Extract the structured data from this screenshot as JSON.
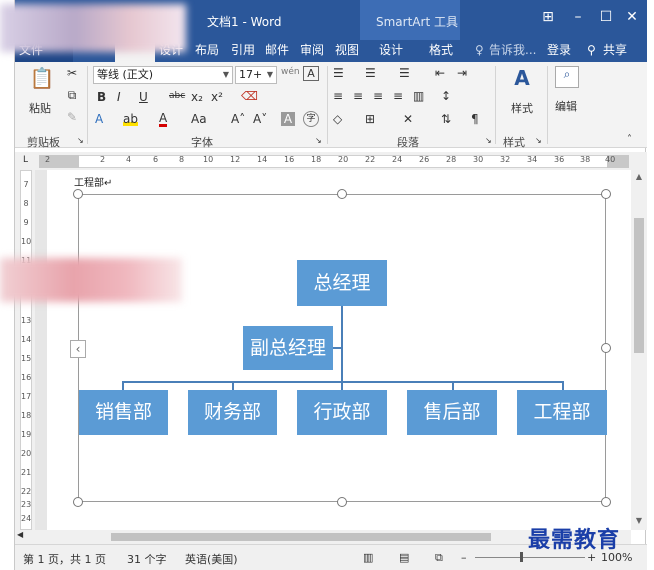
{
  "window": {
    "title": "文档1 - Word",
    "context_tab_group": "SmartArt 工具",
    "controls": [
      "⊞",
      "–",
      "☐",
      "✕"
    ]
  },
  "tabs": {
    "file": "文件",
    "items": [
      "设计",
      "布局",
      "引用",
      "邮件",
      "审阅",
      "视图",
      "设计",
      "格式"
    ],
    "tell_me": "告诉我...",
    "signin": "登录",
    "share": "共享"
  },
  "ribbon": {
    "clipboard": {
      "paste": "粘贴",
      "label": "剪贴板"
    },
    "font": {
      "name": "等线 (正文)",
      "size": "17+",
      "wen": "wén",
      "label": "字体",
      "row1": [
        "B",
        "I",
        "U",
        "abc",
        "x₂",
        "x²"
      ],
      "row2": [
        "A",
        "A",
        "Aa",
        "A˄",
        "A˅",
        "A"
      ]
    },
    "paragraph": {
      "label": "段落"
    },
    "styles": {
      "button": "样式",
      "label": "样式"
    },
    "editing": {
      "button": "编辑"
    }
  },
  "ruler": {
    "h_ticks": [
      "2",
      "2",
      "4",
      "6",
      "8",
      "10",
      "12",
      "14",
      "16",
      "18",
      "20",
      "22",
      "24",
      "26",
      "28",
      "30",
      "32",
      "34",
      "36",
      "38",
      "40"
    ],
    "v_ticks": [
      "7",
      "8",
      "9",
      "10",
      "11",
      "12",
      "13",
      "14",
      "15",
      "16",
      "17",
      "18",
      "19",
      "20",
      "21",
      "22",
      "23",
      "24"
    ]
  },
  "document": {
    "caption": "工程部↵",
    "org_chart": {
      "top": "总经理",
      "assistant": "副总经理",
      "departments": [
        "销售部",
        "财务部",
        "行政部",
        "售后部",
        "工程部"
      ]
    }
  },
  "status": {
    "page": "第 1 页，共 1 页",
    "words": "31 个字",
    "language": "英语(美国)",
    "zoom": "100%"
  },
  "watermark": "最需教育",
  "colors": {
    "word_blue": "#2b579a",
    "node_fill": "#5b9bd5",
    "connector": "#4a7fb8"
  }
}
